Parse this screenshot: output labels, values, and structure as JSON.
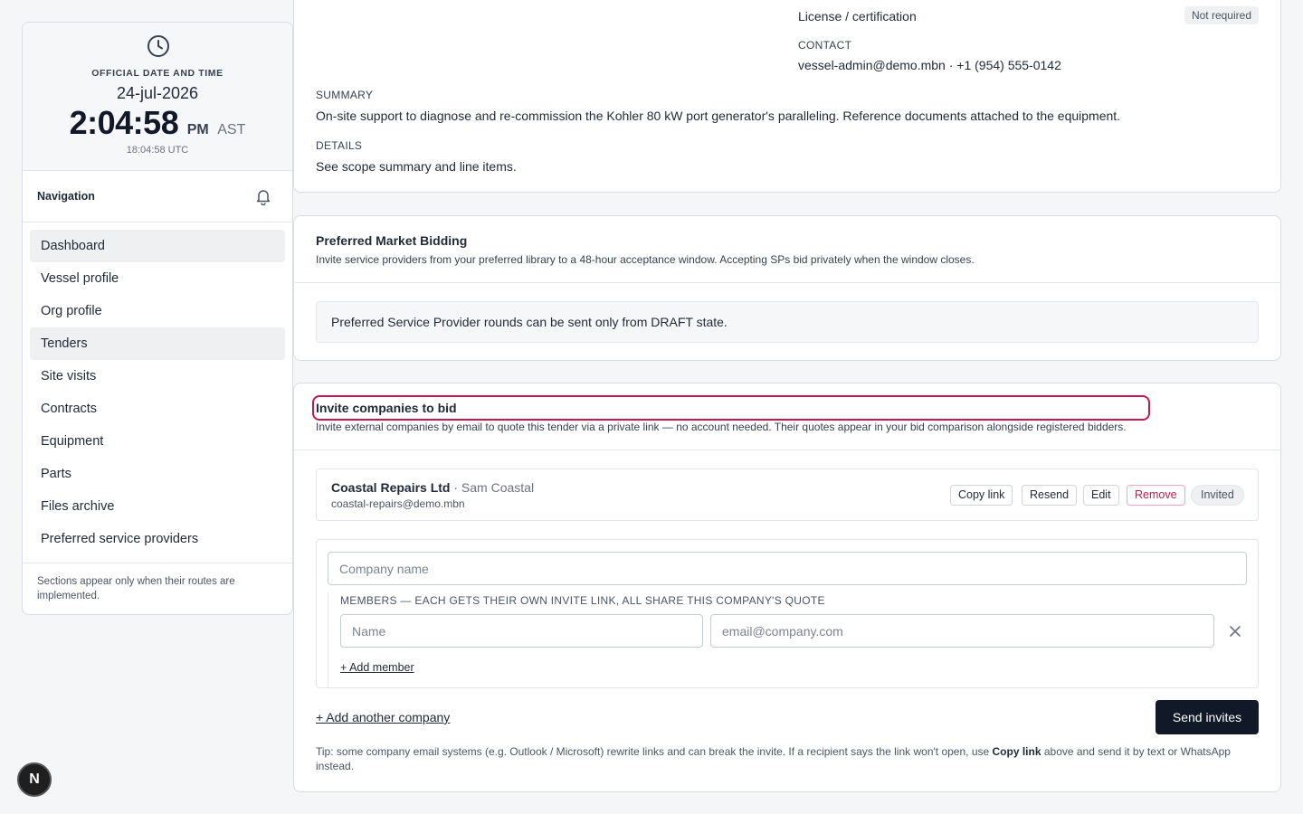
{
  "clock": {
    "label": "OFFICIAL DATE AND TIME",
    "date": "24-jul-2026",
    "time": "2:04:58",
    "ampm": "PM",
    "tz": "AST",
    "utc": "18:04:58 UTC"
  },
  "nav": {
    "title": "Navigation",
    "items": [
      {
        "label": "Dashboard"
      },
      {
        "label": "Vessel profile"
      },
      {
        "label": "Org profile"
      },
      {
        "label": "Tenders"
      },
      {
        "label": "Site visits"
      },
      {
        "label": "Contracts"
      },
      {
        "label": "Equipment"
      },
      {
        "label": "Parts"
      },
      {
        "label": "Files archive"
      },
      {
        "label": "Preferred service providers"
      }
    ],
    "footnote": "Sections appear only when their routes are implemented."
  },
  "tender": {
    "license_label": "License / certification",
    "license_status": "Not required",
    "contact_label": "CONTACT",
    "contact_value": "vessel-admin@demo.mbn · +1 (954) 555-0142",
    "summary_label": "SUMMARY",
    "summary_value": "On-site support to diagnose and re-commission the Kohler 80 kW port generator's paralleling. Reference documents attached to the equipment.",
    "details_label": "DETAILS",
    "details_value": "See scope summary and line items."
  },
  "preferred": {
    "title": "Preferred Market Bidding",
    "subtitle": "Invite service providers from your preferred library to a 48-hour acceptance window. Accepting SPs bid privately when the window closes.",
    "notice": "Preferred Service Provider rounds can be sent only from DRAFT state."
  },
  "invite": {
    "title": "Invite companies to bid",
    "subtitle": "Invite external companies by email to quote this tender via a private link — no account needed. Their quotes appear in your bid comparison alongside registered bidders.",
    "invited": {
      "company": "Coastal Repairs Ltd",
      "contact": "· Sam Coastal",
      "email": "coastal-repairs@demo.mbn",
      "copy_label": "Copy link",
      "resend_label": "Resend",
      "edit_label": "Edit",
      "remove_label": "Remove",
      "status": "Invited"
    },
    "form": {
      "company_placeholder": "Company name",
      "members_label": "MEMBERS — EACH GETS THEIR OWN INVITE LINK, ALL SHARE THIS COMPANY'S QUOTE",
      "name_placeholder": "Name",
      "email_placeholder": "email@company.com",
      "add_member_label": "+ Add member"
    },
    "add_company_label": "+ Add another company",
    "send_label": "Send invites",
    "tip_pre": "Tip: some company email systems (e.g. Outlook / Microsoft) rewrite links and can break the invite. If a recipient says the link won't open, use ",
    "tip_bold": "Copy link",
    "tip_post": " above and send it by text or WhatsApp instead."
  },
  "fab_letter": "N"
}
